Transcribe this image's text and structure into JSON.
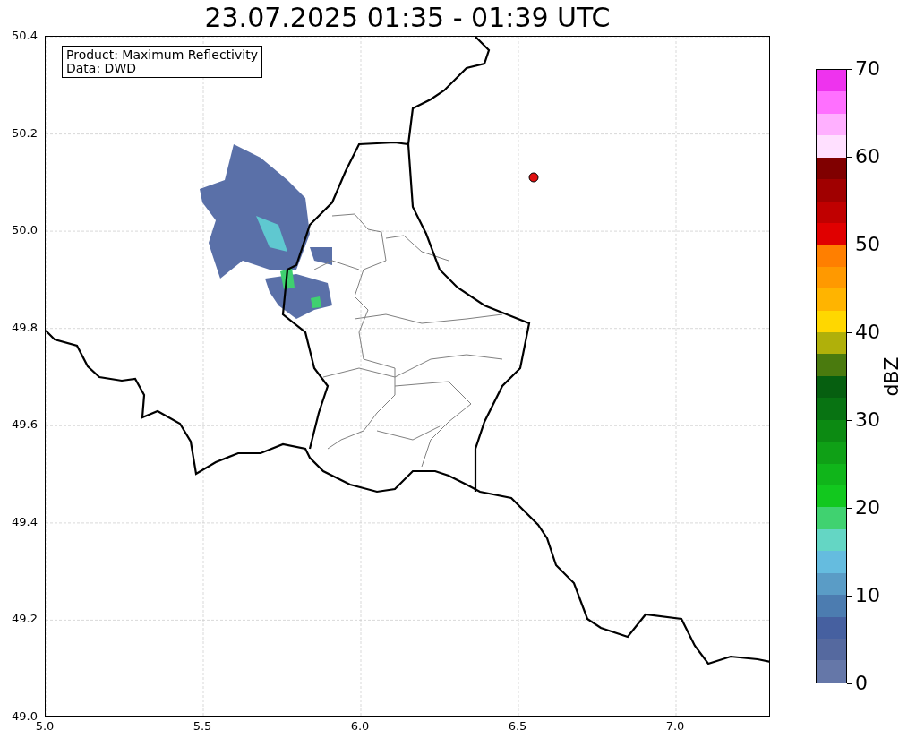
{
  "title": "23.07.2025 01:35 - 01:39 UTC",
  "map": {
    "annotation": [
      "Product: Maximum Reflectivity",
      "Data: DWD"
    ],
    "yticks": [
      "50.4",
      "50.2",
      "50.0",
      "49.8",
      "49.6",
      "49.4",
      "49.2",
      "49.0"
    ],
    "xticks": [
      "5.0",
      "5.5",
      "6.0",
      "6.5",
      "7.0"
    ]
  },
  "colorbar": {
    "label": "dBZ",
    "ticks": [
      "70",
      "60",
      "50",
      "40",
      "30",
      "20",
      "10",
      "0"
    ],
    "segments": [
      {
        "color": "#ee33ee"
      },
      {
        "color": "#ff70ff"
      },
      {
        "color": "#ffb0ff"
      },
      {
        "color": "#ffe0ff"
      },
      {
        "color": "#800000"
      },
      {
        "color": "#a00000"
      },
      {
        "color": "#c00000"
      },
      {
        "color": "#e00000"
      },
      {
        "color": "#ff7f00"
      },
      {
        "color": "#ff9900"
      },
      {
        "color": "#ffb400"
      },
      {
        "color": "#ffd700"
      },
      {
        "color": "#b0b00a"
      },
      {
        "color": "#4a7a0e"
      },
      {
        "color": "#065f10"
      },
      {
        "color": "#087312"
      },
      {
        "color": "#0c8a12"
      },
      {
        "color": "#0fa016"
      },
      {
        "color": "#10b51a"
      },
      {
        "color": "#12c81e"
      },
      {
        "color": "#40d270"
      },
      {
        "color": "#64d6c4"
      },
      {
        "color": "#65bcdf"
      },
      {
        "color": "#5a9cc6"
      },
      {
        "color": "#4c7cb0"
      },
      {
        "color": "#4660a0"
      },
      {
        "color": "#55699f"
      },
      {
        "color": "#6577a8"
      }
    ]
  }
}
